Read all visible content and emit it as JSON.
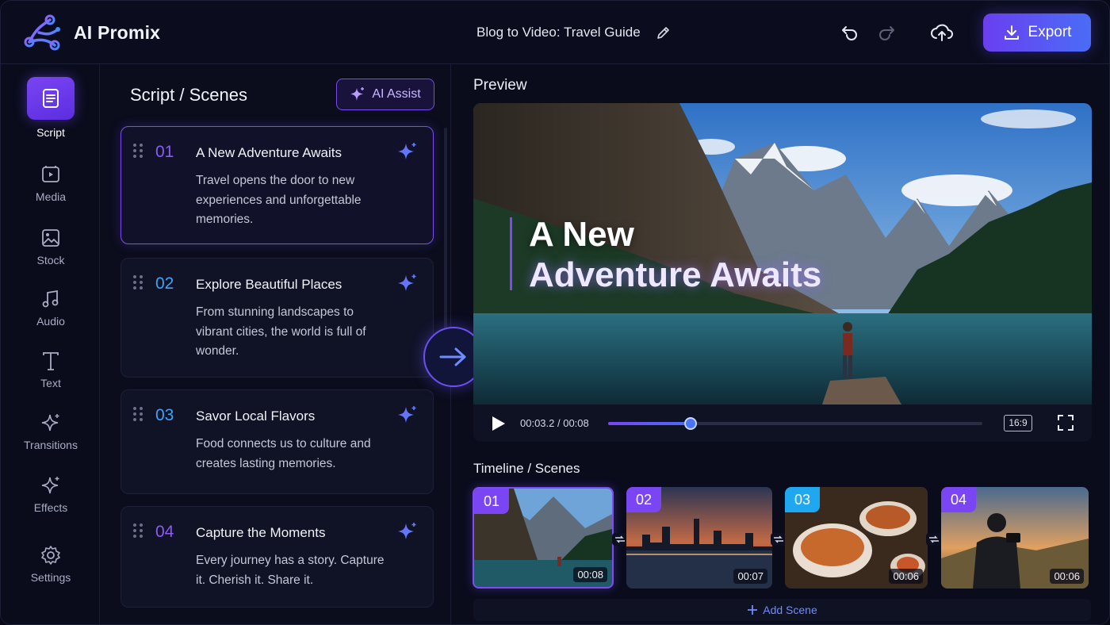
{
  "app": {
    "name": "AI Promix",
    "project_title": "Blog to Video: Travel Guide",
    "export_label": "Export"
  },
  "sidebar": {
    "items": [
      {
        "label": "Script",
        "icon": "document-icon",
        "active": true
      },
      {
        "label": "Media",
        "icon": "media-icon"
      },
      {
        "label": "Stock",
        "icon": "image-icon"
      },
      {
        "label": "Audio",
        "icon": "music-note-icon"
      },
      {
        "label": "Text",
        "icon": "text-icon"
      },
      {
        "label": "Transitions",
        "icon": "sparkle-icon"
      },
      {
        "label": "Effects",
        "icon": "sparkle-icon"
      },
      {
        "label": "Settings",
        "icon": "gear-icon"
      }
    ]
  },
  "script": {
    "title": "Script / Scenes",
    "ai_assist_label": "AI Assist",
    "scenes": [
      {
        "num": "01",
        "title": "A New Adventure Awaits",
        "body": "Travel opens the door to new experiences and unforgettable memories.",
        "num_color": "#8a5cf6"
      },
      {
        "num": "02",
        "title": "Explore Beautiful Places",
        "body": "From stunning landscapes to vibrant cities, the world is full of wonder.",
        "num_color": "#3fa3f5"
      },
      {
        "num": "03",
        "title": "Savor Local Flavors",
        "body": "Food connects us to culture and creates lasting memories.",
        "num_color": "#3fa3f5"
      },
      {
        "num": "04",
        "title": "Capture the Moments",
        "body": "Every journey has a story. Capture it. Cherish it. Share it.",
        "num_color": "#8a5cf6"
      }
    ]
  },
  "preview": {
    "label": "Preview",
    "overlay_line1": "A New",
    "overlay_line2": "Adventure Awaits",
    "time": "00:03.2 / 00:08",
    "progress": 0.22,
    "aspect_ratio": "16:9"
  },
  "timeline": {
    "label": "Timeline / Scenes",
    "add_scene_label": "Add Scene",
    "clips": [
      {
        "num": "01",
        "duration": "00:08",
        "badge_color": "#7a45f2"
      },
      {
        "num": "02",
        "duration": "00:07",
        "badge_color": "#7a45f2"
      },
      {
        "num": "03",
        "duration": "00:06",
        "badge_color": "#1fa8f0"
      },
      {
        "num": "04",
        "duration": "00:06",
        "badge_color": "#7a45f2"
      }
    ]
  },
  "colors": {
    "accent": "#7a45f2",
    "accent_blue": "#4a6cf6",
    "background": "#0a0c1c"
  }
}
